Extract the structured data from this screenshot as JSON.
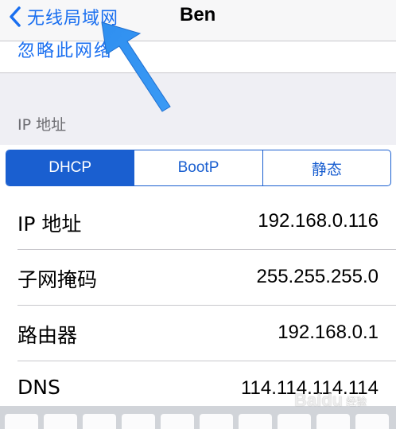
{
  "navbar": {
    "back_label": "无线局域网",
    "title": "Ben"
  },
  "ignore_network": {
    "label": "忽略此网络"
  },
  "section": {
    "header": "IP 地址"
  },
  "segmented": {
    "options": [
      "DHCP",
      "BootP",
      "静态"
    ],
    "selected": "DHCP"
  },
  "rows": [
    {
      "label": "IP 地址",
      "value": "192.168.0.116"
    },
    {
      "label": "子网掩码",
      "value": "255.255.255.0"
    },
    {
      "label": "路由器",
      "value": "192.168.0.1"
    },
    {
      "label": "DNS",
      "value": "114.114.114.114"
    }
  ],
  "watermark": {
    "text": "Baidu",
    "sub": "经验"
  },
  "colors": {
    "accent": "#1a5fd0",
    "link": "#1a6ff0",
    "arrow": "#2f8ff0"
  },
  "icons": {
    "back": "chevron-left-icon",
    "annotation": "arrow-icon"
  }
}
